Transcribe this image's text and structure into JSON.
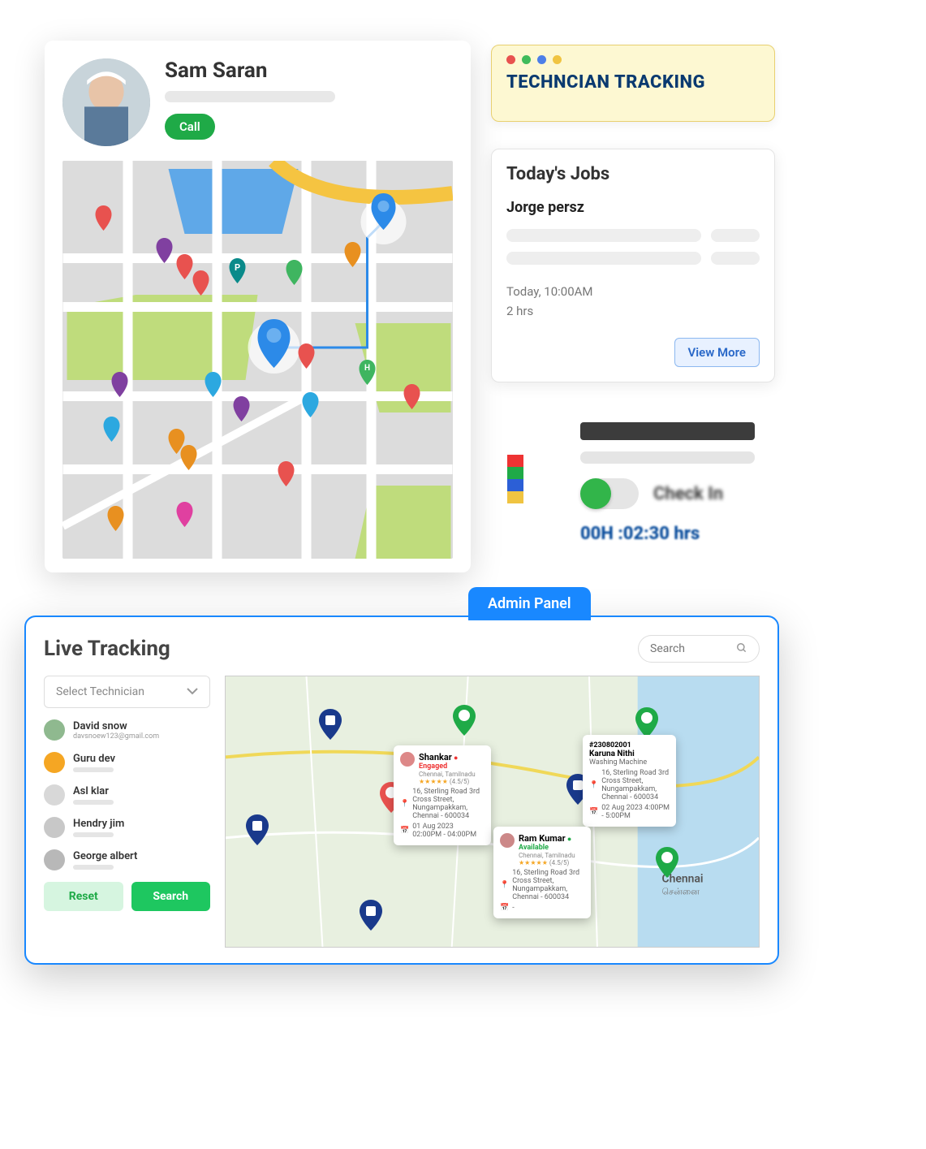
{
  "profile": {
    "name": "Sam Saran",
    "call_label": "Call"
  },
  "tracking_banner": {
    "title": "TECHNCIAN TRACKING",
    "dots": [
      "#e8524f",
      "#3fbb5b",
      "#4d7fe8",
      "#f0c441"
    ]
  },
  "todays_jobs": {
    "title": "Today's Jobs",
    "customer": "Jorge persz",
    "time": "Today, 10:00AM",
    "duration": "2 hrs",
    "view_more_label": "View More"
  },
  "checkin": {
    "legend_colors": [
      "#e33",
      "#1faa47",
      "#2c5fd6",
      "#f0c441"
    ],
    "toggle_label": "Check In",
    "hours": "00H :02:30 hrs"
  },
  "admin": {
    "tab_label": "Admin Panel",
    "title": "Live Tracking",
    "search_placeholder": "Search",
    "select_placeholder": "Select Technician",
    "reset_label": "Reset",
    "search_label": "Search",
    "technicians": [
      {
        "name": "David snow",
        "email": "davsnoew123@gmail.com",
        "avatar_color": "#8fb98f"
      },
      {
        "name": "Guru dev",
        "email": "",
        "avatar_color": "#f5a623"
      },
      {
        "name": "Asl klar",
        "email": "",
        "avatar_color": "#d8d8d8"
      },
      {
        "name": "Hendry jim",
        "email": "",
        "avatar_color": "#c8c8c8"
      },
      {
        "name": "George albert",
        "email": "",
        "avatar_color": "#b8b8b8"
      }
    ],
    "popups": {
      "shankar": {
        "name": "Shankar",
        "status": "Engaged",
        "location": "Chennai, Tamilnadu",
        "rating": "(4.5/5)",
        "address": "16, Sterling Road 3rd Cross Street, Nungampakkam, Chennai - 600034",
        "datetime": "01 Aug 2023  02:00PM -  04:00PM"
      },
      "job": {
        "id": "#230802001",
        "customer": "Karuna Nithi",
        "service": "Washing Machine",
        "address": "16, Sterling Road 3rd Cross Street, Nungampakkam, Chennai - 600034",
        "datetime": "02 Aug 2023 4:00PM - 5:00PM"
      },
      "ram": {
        "name": "Ram Kumar",
        "status": "Available",
        "location": "Chennai, Tamilnadu",
        "rating": "(4.5/5)",
        "address": "16, Sterling Road 3rd Cross Street, Nungampakkam, Chennai - 600034"
      }
    },
    "map_label_chennai": "Chennai",
    "map_label_chennai_tamil": "சென்னை"
  }
}
